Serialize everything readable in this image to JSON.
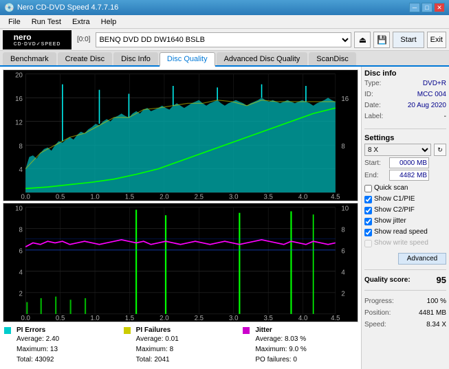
{
  "app": {
    "title": "Nero CD-DVD Speed 4.7.7.16",
    "drive_label": "[0:0]",
    "drive_name": "BENQ DVD DD DW1640 BSLB"
  },
  "menu": {
    "items": [
      "File",
      "Run Test",
      "Extra",
      "Help"
    ]
  },
  "toolbar": {
    "start_label": "Start",
    "exit_label": "Exit"
  },
  "tabs": {
    "items": [
      "Benchmark",
      "Create Disc",
      "Disc Info",
      "Disc Quality",
      "Advanced Disc Quality",
      "ScanDisc"
    ],
    "active": "Disc Quality"
  },
  "disc_info": {
    "section_title": "Disc info",
    "type_label": "Type:",
    "type_value": "DVD+R",
    "id_label": "ID:",
    "id_value": "MCC 004",
    "date_label": "Date:",
    "date_value": "20 Aug 2020",
    "label_label": "Label:",
    "label_value": "-"
  },
  "settings": {
    "section_title": "Settings",
    "speed": "8 X",
    "start_label": "Start:",
    "start_value": "0000 MB",
    "end_label": "End:",
    "end_value": "4482 MB",
    "checkboxes": {
      "quick_scan": {
        "label": "Quick scan",
        "checked": false
      },
      "show_c1pie": {
        "label": "Show C1/PIE",
        "checked": true
      },
      "show_c2pif": {
        "label": "Show C2/PIF",
        "checked": true
      },
      "show_jitter": {
        "label": "Show jitter",
        "checked": true
      },
      "show_read_speed": {
        "label": "Show read speed",
        "checked": true
      },
      "show_write_speed": {
        "label": "Show write speed",
        "checked": false
      }
    },
    "advanced_label": "Advanced"
  },
  "quality": {
    "score_label": "Quality score:",
    "score_value": "95",
    "progress_label": "Progress:",
    "progress_value": "100 %",
    "position_label": "Position:",
    "position_value": "4481 MB",
    "speed_label": "Speed:",
    "speed_value": "8.34 X"
  },
  "stats": {
    "pi_errors": {
      "label": "PI Errors",
      "color": "#00cccc",
      "avg_label": "Average:",
      "avg_value": "2.40",
      "max_label": "Maximum:",
      "max_value": "13",
      "total_label": "Total:",
      "total_value": "43092"
    },
    "pi_failures": {
      "label": "PI Failures",
      "color": "#cccc00",
      "avg_label": "Average:",
      "avg_value": "0.01",
      "max_label": "Maximum:",
      "max_value": "8",
      "total_label": "Total:",
      "total_value": "2041"
    },
    "jitter": {
      "label": "Jitter",
      "color": "#cc00cc",
      "avg_label": "Average:",
      "avg_value": "8.03 %",
      "max_label": "Maximum:",
      "max_value": "9.0 %",
      "po_label": "PO failures:",
      "po_value": "0"
    }
  },
  "chart1": {
    "y_max": 20,
    "y_labels": [
      "20",
      "16",
      "12",
      "8",
      "4"
    ],
    "x_labels": [
      "0.0",
      "0.5",
      "1.0",
      "1.5",
      "2.0",
      "2.5",
      "3.0",
      "3.5",
      "4.0",
      "4.5"
    ],
    "right_labels": [
      "16",
      "8"
    ]
  },
  "chart2": {
    "y_max": 10,
    "y_labels": [
      "10",
      "8",
      "6",
      "4",
      "2"
    ],
    "x_labels": [
      "0.0",
      "0.5",
      "1.0",
      "1.5",
      "2.0",
      "2.5",
      "3.0",
      "3.5",
      "4.0",
      "4.5"
    ],
    "right_labels": [
      "10",
      "8",
      "6",
      "4",
      "2"
    ]
  }
}
